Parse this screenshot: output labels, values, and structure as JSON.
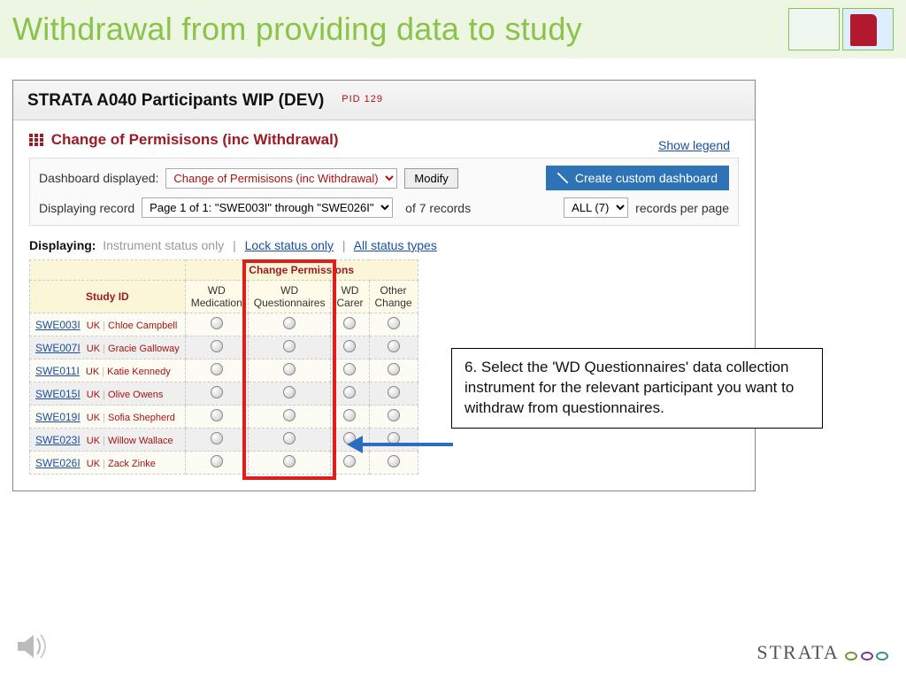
{
  "banner": {
    "title": "Withdrawal from providing data to study"
  },
  "panel": {
    "title": "STRATA A040 Participants WIP (DEV)",
    "pid": "PID  129",
    "section": "Change of Permisisons (inc Withdrawal)",
    "show_legend": "Show legend"
  },
  "controls": {
    "dash_label": "Dashboard displayed:",
    "dash_value": "Change of Permisisons (inc Withdrawal)",
    "modify": "Modify",
    "create": "Create custom dashboard",
    "disp_label": "Displaying record",
    "page_value": "Page 1 of 1: \"SWE003I\" through \"SWE026I\"",
    "of_records": "of 7 records",
    "perpage_value": "ALL (7)",
    "perpage_suffix": "records per page"
  },
  "displaying": {
    "label": "Displaying:",
    "opt1": "Instrument status only",
    "opt2": "Lock status only",
    "opt3": "All status types"
  },
  "table": {
    "group_header": "Change Permissions",
    "id_header": "Study ID",
    "cols": [
      "WD Medication",
      "WD Questionnaires",
      "WD Carer",
      "Other Change"
    ],
    "rows": [
      {
        "id": "SWE003I",
        "site": "UK",
        "name": "Chloe Campbell"
      },
      {
        "id": "SWE007I",
        "site": "UK",
        "name": "Gracie Galloway"
      },
      {
        "id": "SWE011I",
        "site": "UK",
        "name": "Katie Kennedy"
      },
      {
        "id": "SWE015I",
        "site": "UK",
        "name": "Olive Owens"
      },
      {
        "id": "SWE019I",
        "site": "UK",
        "name": "Sofia Shepherd"
      },
      {
        "id": "SWE023I",
        "site": "UK",
        "name": "Willow Wallace"
      },
      {
        "id": "SWE026I",
        "site": "UK",
        "name": "Zack Zinke"
      }
    ]
  },
  "callout": "6. Select the 'WD Questionnaires' data collection instrument for the relevant participant you want to withdraw from questionnaires.",
  "footer": {
    "logo": "STRATA"
  }
}
